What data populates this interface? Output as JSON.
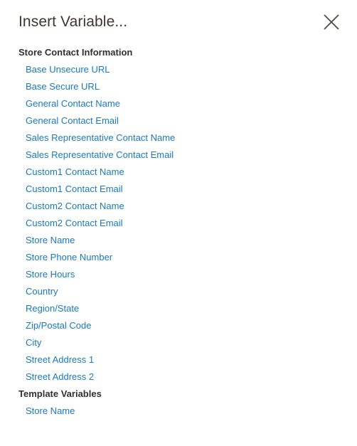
{
  "modal": {
    "title": "Insert Variable...",
    "close_label": "Close",
    "close_icon": "close-icon",
    "accent_link_color": "#1979c3",
    "title_color": "#41362f",
    "group_title_color": "#303030",
    "background_color": "#ffffff"
  },
  "groups": [
    {
      "title": "Store Contact Information",
      "items": [
        {
          "label": "Base Unsecure URL"
        },
        {
          "label": "Base Secure URL"
        },
        {
          "label": "General Contact Name"
        },
        {
          "label": "General Contact Email"
        },
        {
          "label": "Sales Representative Contact Name"
        },
        {
          "label": "Sales Representative Contact Email"
        },
        {
          "label": "Custom1 Contact Name"
        },
        {
          "label": "Custom1 Contact Email"
        },
        {
          "label": "Custom2 Contact Name"
        },
        {
          "label": "Custom2 Contact Email"
        },
        {
          "label": "Store Name"
        },
        {
          "label": "Store Phone Number"
        },
        {
          "label": "Store Hours"
        },
        {
          "label": "Country"
        },
        {
          "label": "Region/State"
        },
        {
          "label": "Zip/Postal Code"
        },
        {
          "label": "City"
        },
        {
          "label": "Street Address 1"
        },
        {
          "label": "Street Address 2"
        }
      ]
    },
    {
      "title": "Template Variables",
      "items": [
        {
          "label": "Store Name"
        }
      ]
    }
  ]
}
